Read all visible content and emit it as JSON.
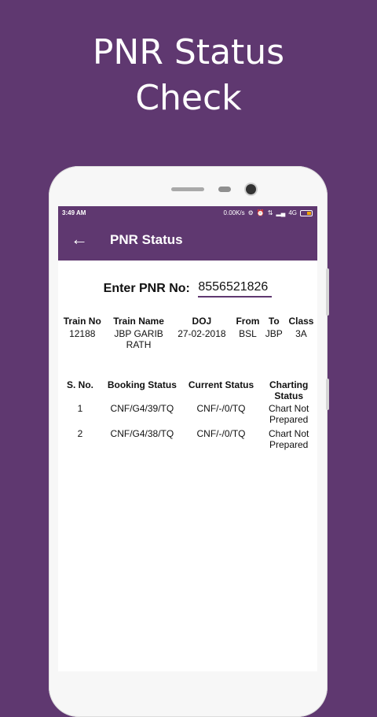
{
  "promo": {
    "line1": "PNR Status",
    "line2": "Check"
  },
  "statusbar": {
    "time": "3:49 AM",
    "network_speed": "0.00K/s",
    "network_type": "4G"
  },
  "appbar": {
    "title": "PNR Status",
    "back_icon": "back-arrow-icon"
  },
  "pnr": {
    "label": "Enter PNR No:",
    "value": "8556521826"
  },
  "train_table": {
    "headers": [
      "Train No",
      "Train Name",
      "DOJ",
      "From",
      "To",
      "Class"
    ],
    "row": [
      "12188",
      "JBP GARIB RATH",
      "27-02-2018",
      "BSL",
      "JBP",
      "3A"
    ]
  },
  "status_table": {
    "headers": [
      "S. No.",
      "Booking Status",
      "Current Status",
      "Charting Status"
    ],
    "rows": [
      [
        "1",
        "CNF/G4/39/TQ",
        "CNF/-/0/TQ",
        "Chart Not Prepared"
      ],
      [
        "2",
        "CNF/G4/38/TQ",
        "CNF/-/0/TQ",
        "Chart Not Prepared"
      ]
    ]
  },
  "colors": {
    "brand": "#5f3870",
    "battery": "#f0a500"
  }
}
